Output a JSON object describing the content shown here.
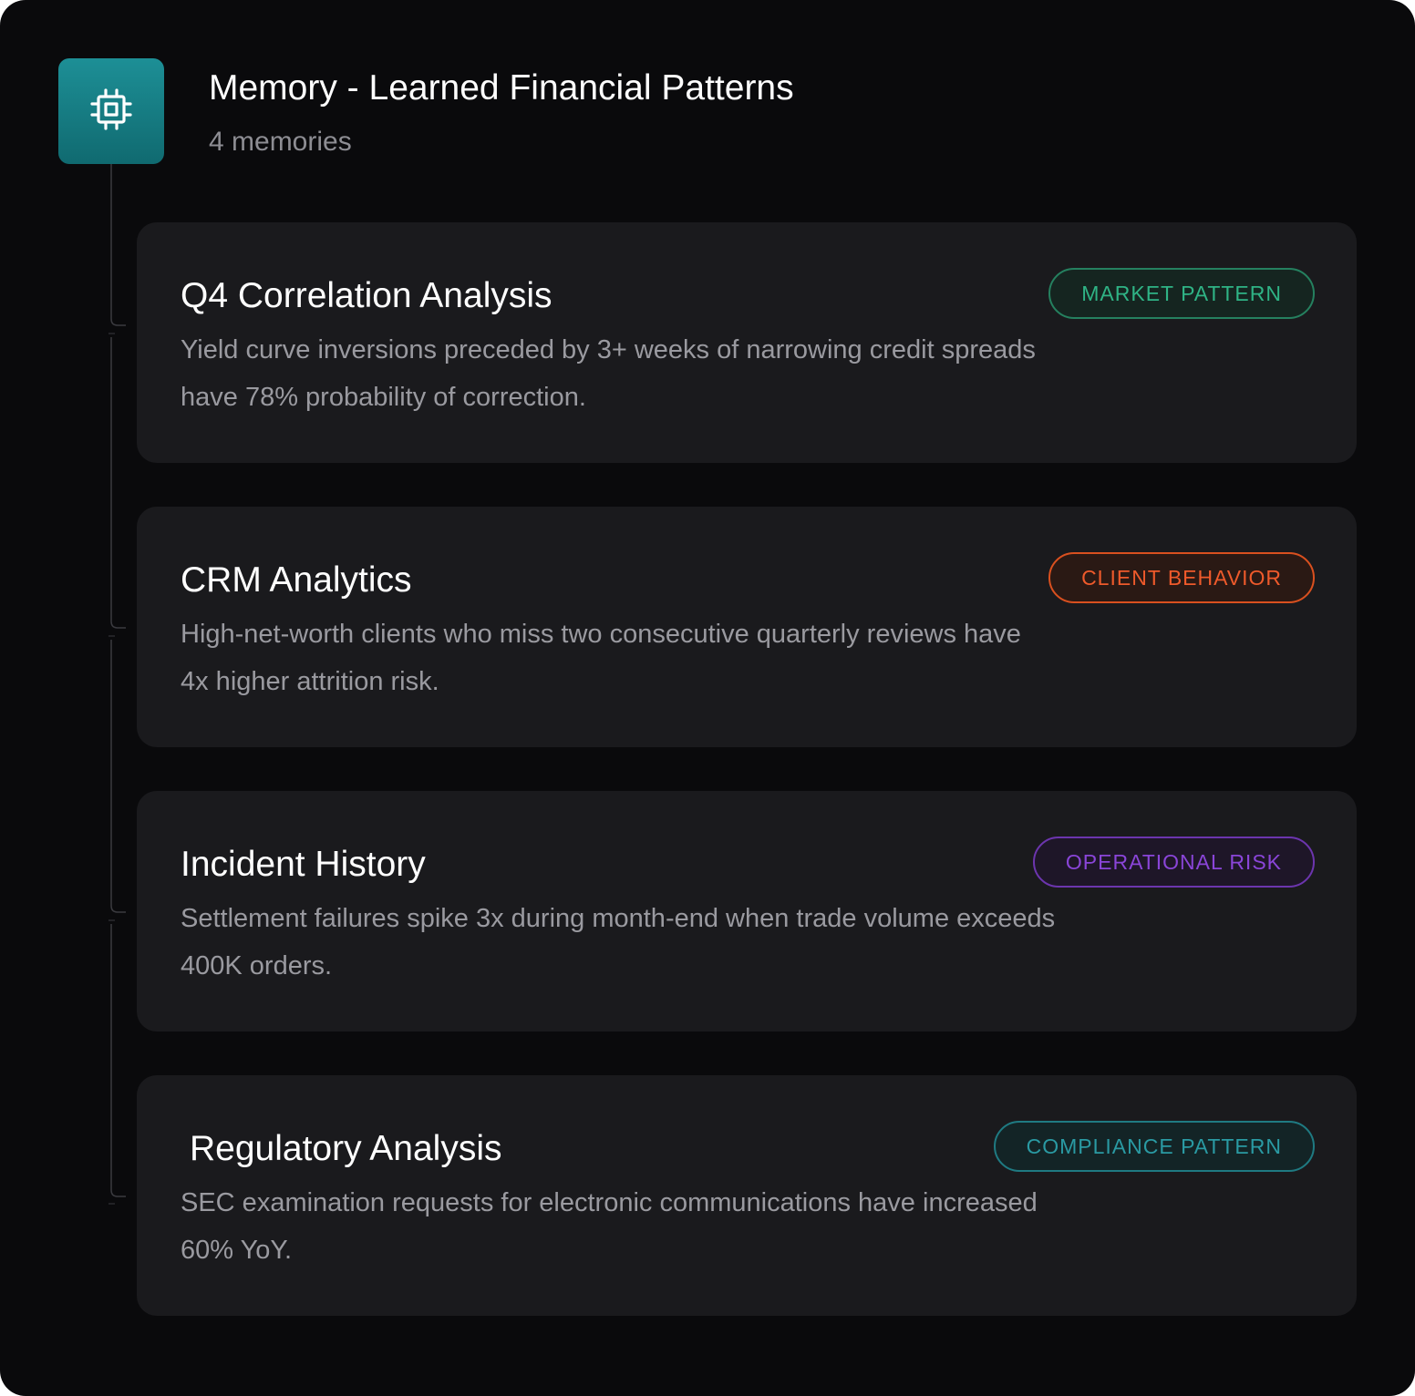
{
  "header": {
    "title": "Memory - Learned Financial Patterns",
    "subtitle": "4 memories",
    "icon": "cpu-chip-icon"
  },
  "colors": {
    "panel_bg": "#0a0a0c",
    "card_bg": "#1a1a1d",
    "icon_tile": "#17828a",
    "market": "#2fb385",
    "client": "#ee5a2b",
    "operational": "#8a45d8",
    "compliance": "#2a9aa3"
  },
  "memories": [
    {
      "title": "Q4 Correlation Analysis",
      "description": "Yield curve inversions preceded by 3+ weeks of narrowing credit spreads have 78% probability of correction.",
      "badge": "MARKET PATTERN"
    },
    {
      "title": "CRM Analytics",
      "description": "High-net-worth clients who miss two consecutive quarterly reviews have 4x higher attrition risk.",
      "badge": "CLIENT BEHAVIOR"
    },
    {
      "title": "Incident History",
      "description": "Settlement failures spike 3x during month-end when trade volume exceeds 400K orders.",
      "badge": "OPERATIONAL RISK"
    },
    {
      "title": "Regulatory Analysis",
      "description": "SEC examination requests for electronic communications have increased 60% YoY.",
      "badge": "COMPLIANCE PATTERN"
    }
  ]
}
